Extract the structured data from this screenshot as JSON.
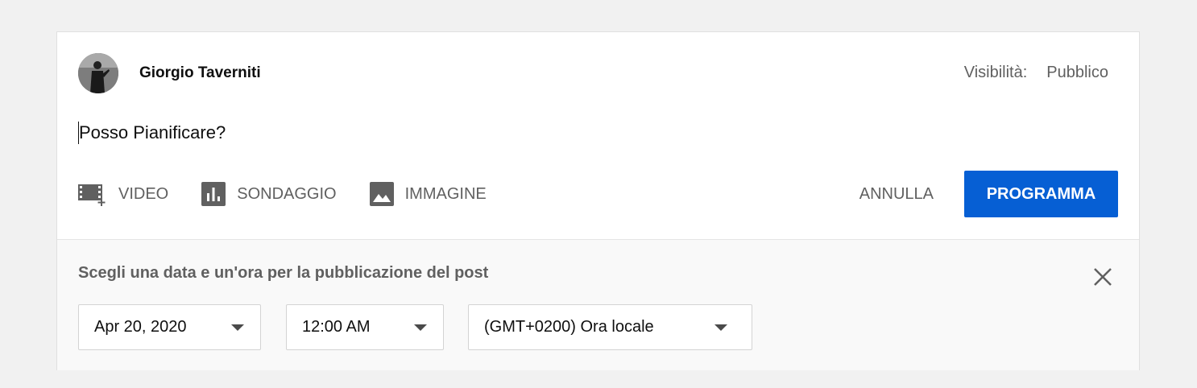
{
  "post": {
    "author": "Giorgio Taverniti",
    "visibility_label": "Visibilità:",
    "visibility_value": "Pubblico",
    "text": "Posso Pianificare?"
  },
  "attachments": [
    {
      "label": "VIDEO",
      "icon": "video-add-icon"
    },
    {
      "label": "SONDAGGIO",
      "icon": "poll-icon"
    },
    {
      "label": "IMMAGINE",
      "icon": "image-icon"
    }
  ],
  "actions": {
    "cancel_label": "ANNULLA",
    "schedule_label": "PROGRAMMA",
    "schedule_color": "#065fd4"
  },
  "schedule": {
    "title": "Scegli una data e un'ora per la pubblicazione del post",
    "date": "Apr 20, 2020",
    "time": "12:00 AM",
    "timezone": "(GMT+0200) Ora locale",
    "close_icon": "close-icon"
  }
}
